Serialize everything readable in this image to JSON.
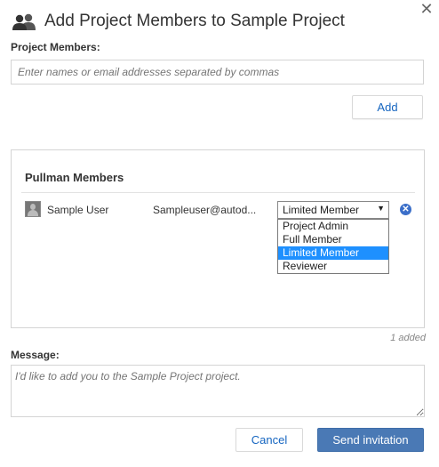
{
  "dialog": {
    "title": "Add Project Members to Sample Project",
    "close_symbol": "✕",
    "icon": "users-icon"
  },
  "project_members": {
    "label": "Project Members:",
    "placeholder": "Enter names or email addresses separated by commas",
    "value": "",
    "add_label": "Add"
  },
  "pullman": {
    "title": "Pullman Members",
    "members": [
      {
        "name": "Sample User",
        "email": "Sampleuser@autod...",
        "role": "Limited Member",
        "avatar": "user-avatar-icon",
        "remove_icon": "remove-circle-icon"
      }
    ],
    "dropdown_arrow": "▼",
    "role_options": [
      "Project Admin",
      "Full Member",
      "Limited Member",
      "Reviewer"
    ],
    "role_selected_index": 2,
    "remove_symbol": "✕",
    "added_count": "1 added"
  },
  "message": {
    "label": "Message:",
    "placeholder": "I'd like to add you to the Sample Project project.",
    "value": ""
  },
  "footer": {
    "cancel_label": "Cancel",
    "send_label": "Send invitation"
  },
  "colors": {
    "primary": "#4a79b5",
    "link": "#1565c0",
    "selected_option": "#1e90ff",
    "remove_button": "#3b6fc9"
  }
}
